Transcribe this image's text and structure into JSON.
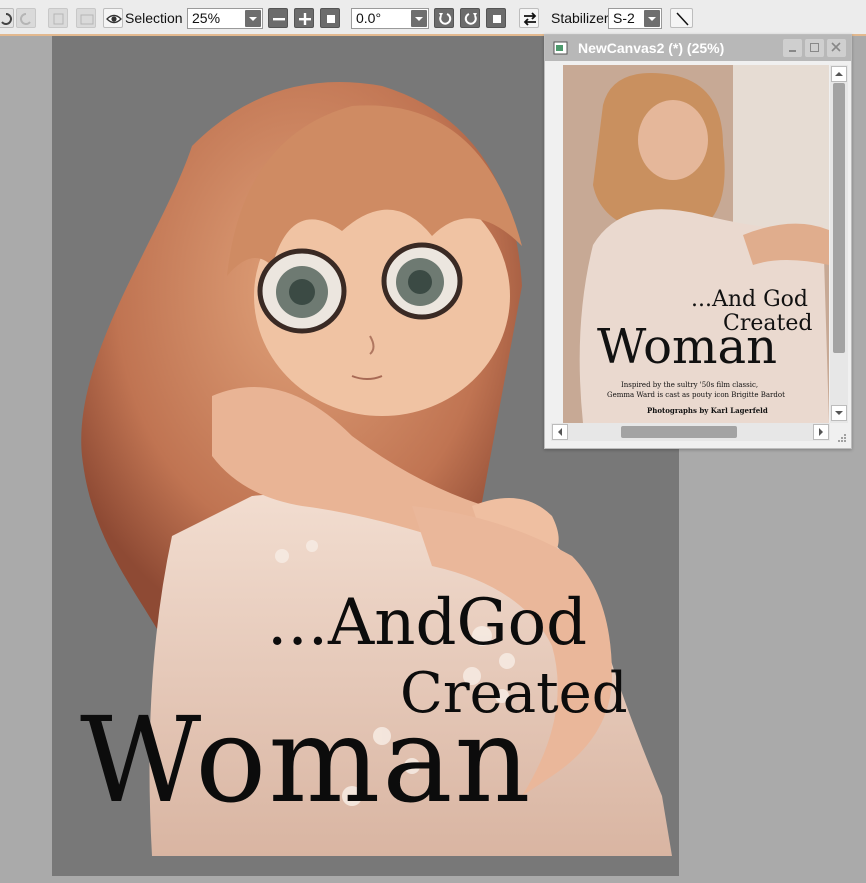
{
  "toolbar": {
    "selection_label": "Selection",
    "zoom_value": "25%",
    "rotation_value": "0.0°",
    "stabilizer_label": "Stabilizer",
    "stabilizer_value": "S-2"
  },
  "canvas": {
    "title_line1": "...AndGod",
    "title_line2": "Created",
    "title_line3": "Woman"
  },
  "subwindow": {
    "title": "NewCanvas2 (*) (25%)",
    "magazine": {
      "line1": "...And God",
      "line2": "Created",
      "line3": "Woman",
      "caption1": "Inspired by the sultry '50s film classic,",
      "caption2": "Gemma Ward is cast as pouty icon Brigitte Bardot",
      "credit": "Photographs by Karl Lagerfeld"
    }
  },
  "colors": {
    "toolbar_bg": "#ececec",
    "toolbar_accent": "#e3b98f",
    "workspace": "#aaaaaa",
    "artboard": "#787878",
    "subwindow_titlebar": "#b8b8b8"
  }
}
